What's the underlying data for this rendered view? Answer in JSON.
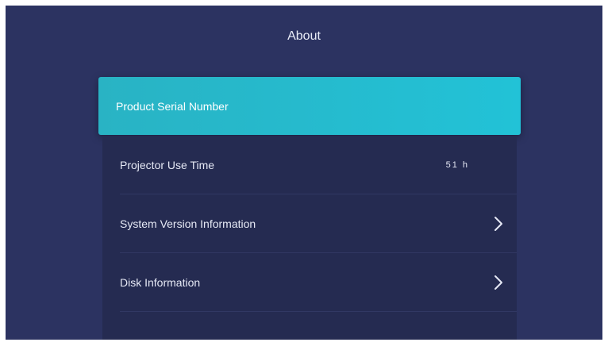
{
  "header": {
    "title": "About"
  },
  "menu": {
    "selected_item": {
      "label": "Product Serial Number"
    },
    "items": [
      {
        "label": "Projector Use Time",
        "value": "51  h",
        "icon": "none"
      },
      {
        "label": "System Version Information",
        "icon": "chevron-right-icon"
      },
      {
        "label": "Disk Information",
        "icon": "chevron-right-icon"
      }
    ]
  },
  "colors": {
    "background": "#2c3361",
    "list_background": "#252b51",
    "highlight": "#22c2d7",
    "text": "#e6e9f5"
  }
}
